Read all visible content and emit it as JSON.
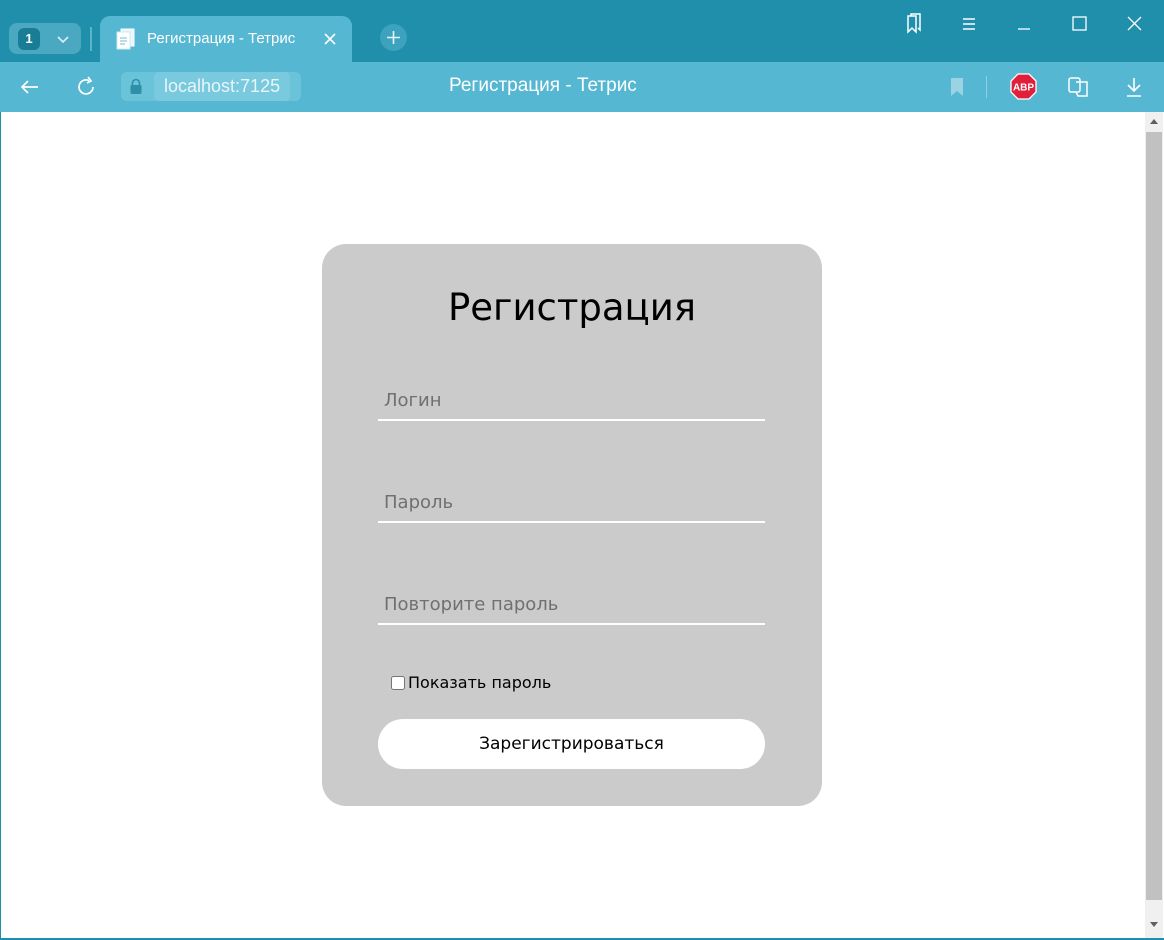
{
  "browser": {
    "tab_count": "1",
    "tab_title": "Регистрация - Тетрис",
    "url": "localhost:7125",
    "page_title": "Регистрация - Тетрис",
    "adblock_label": "ABP"
  },
  "form": {
    "title": "Регистрация",
    "login_placeholder": "Логин",
    "password_placeholder": "Пароль",
    "repeat_password_placeholder": "Повторите пароль",
    "show_password_label": "Показать пароль",
    "submit_label": "Зарегистрироваться"
  },
  "colors": {
    "titlebar": "#1f8fab",
    "toolbar": "#55b7d2",
    "card": "#cbcbcb",
    "abp": "#e0203a"
  }
}
